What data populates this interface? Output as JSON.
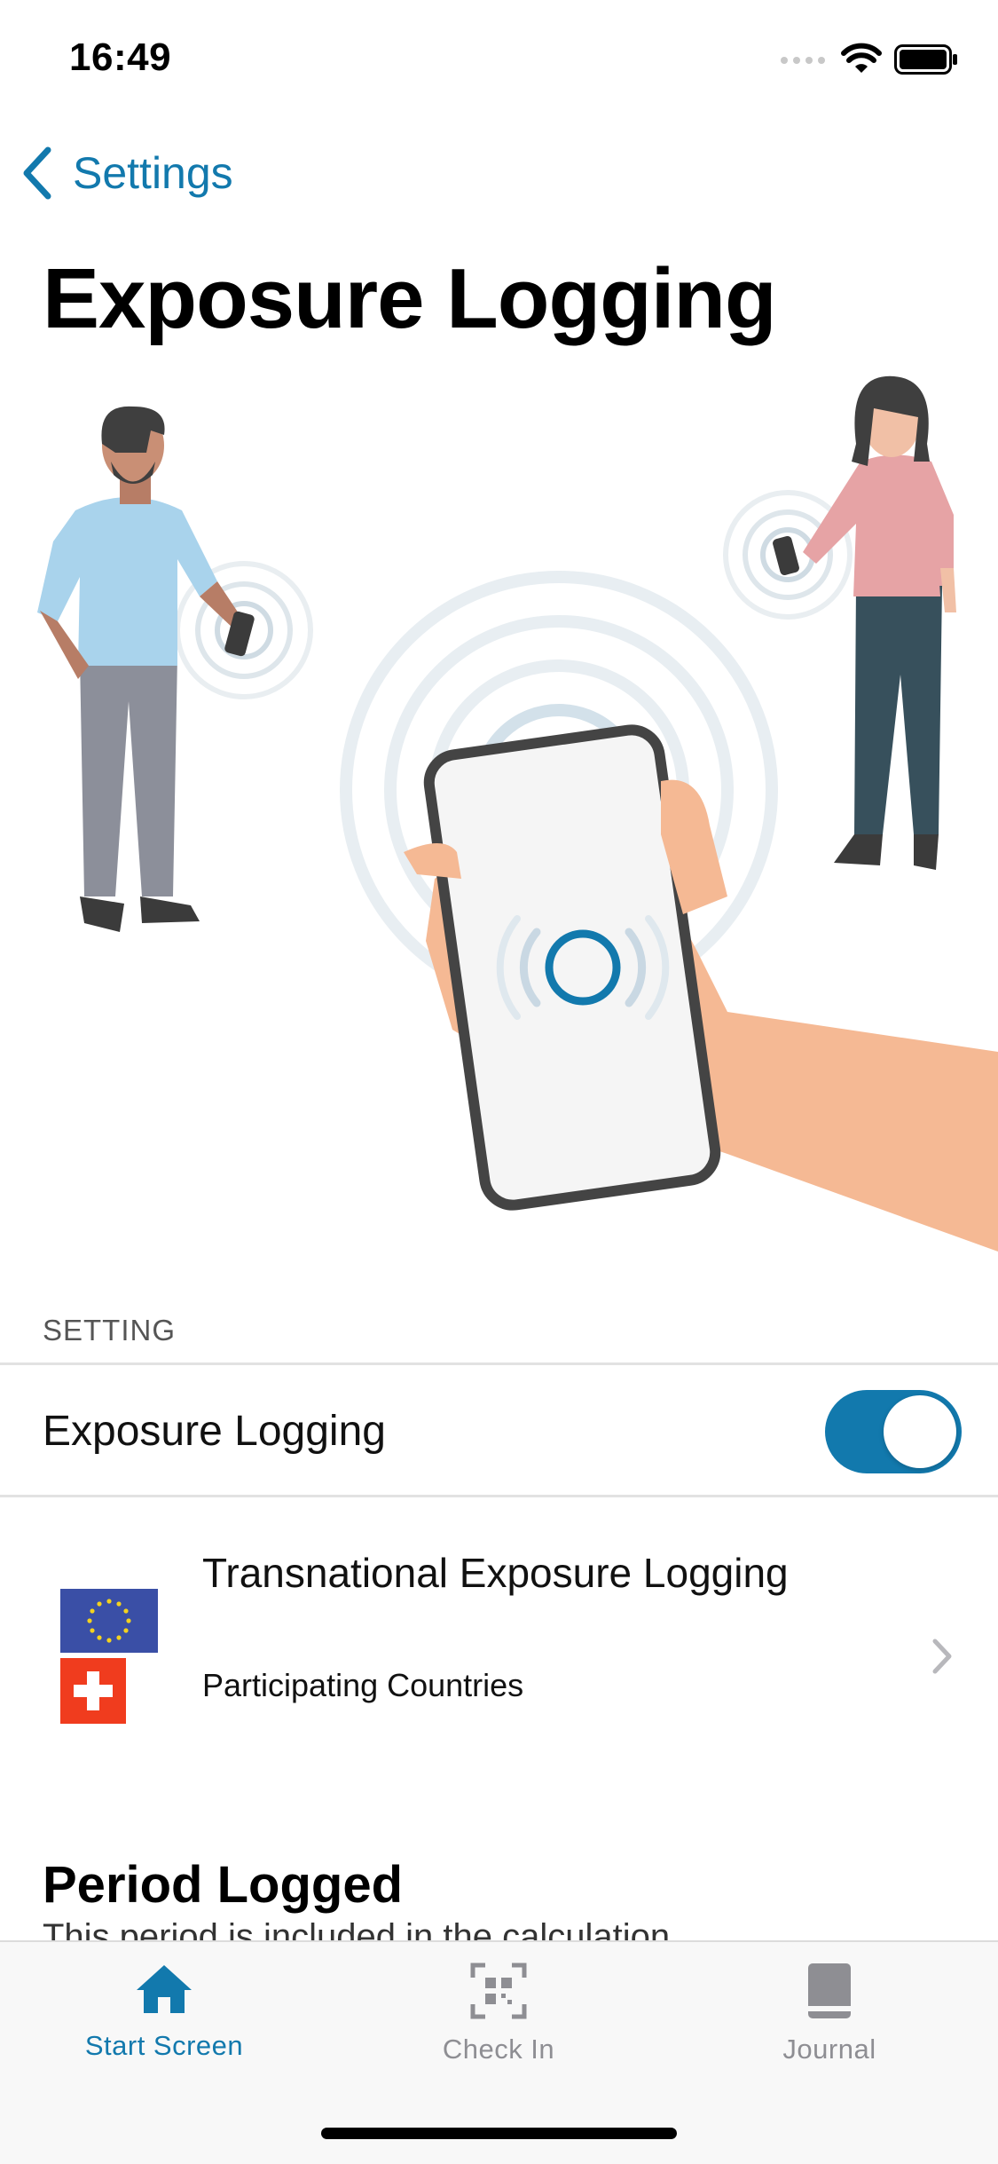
{
  "status_bar": {
    "time": "16:49"
  },
  "nav": {
    "back_label": "Settings",
    "title": "Exposure Logging"
  },
  "setting_section": {
    "header": "SETTING",
    "toggle_row": {
      "label": "Exposure Logging",
      "enabled": true
    },
    "transnational_row": {
      "title": "Transnational Exposure Logging",
      "subtitle": "Participating Countries"
    }
  },
  "period_section": {
    "title": "Period Logged",
    "subtitle": "This period is included in the calculation"
  },
  "tab_bar": {
    "tabs": [
      {
        "label": "Start Screen",
        "active": true
      },
      {
        "label": "Check In",
        "active": false
      },
      {
        "label": "Journal",
        "active": false
      }
    ]
  },
  "colors": {
    "accent": "#1279ad",
    "inactive": "#8e8e93"
  }
}
